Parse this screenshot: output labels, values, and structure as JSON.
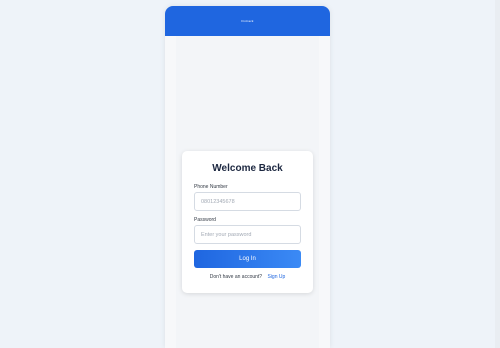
{
  "header": {
    "brand": "Fintrack"
  },
  "login": {
    "title": "Welcome Back",
    "phone_label": "Phone Number",
    "phone_placeholder": "08012345678",
    "password_label": "Password",
    "password_placeholder": "Enter your password",
    "submit_label": "Log In",
    "signup_prompt": "Don't have an account?",
    "signup_link": "Sign Up"
  },
  "colors": {
    "primary": "#1f66e0",
    "page_background": "#eef3f9",
    "card_background": "#ffffff",
    "title_text": "#1c2740"
  }
}
